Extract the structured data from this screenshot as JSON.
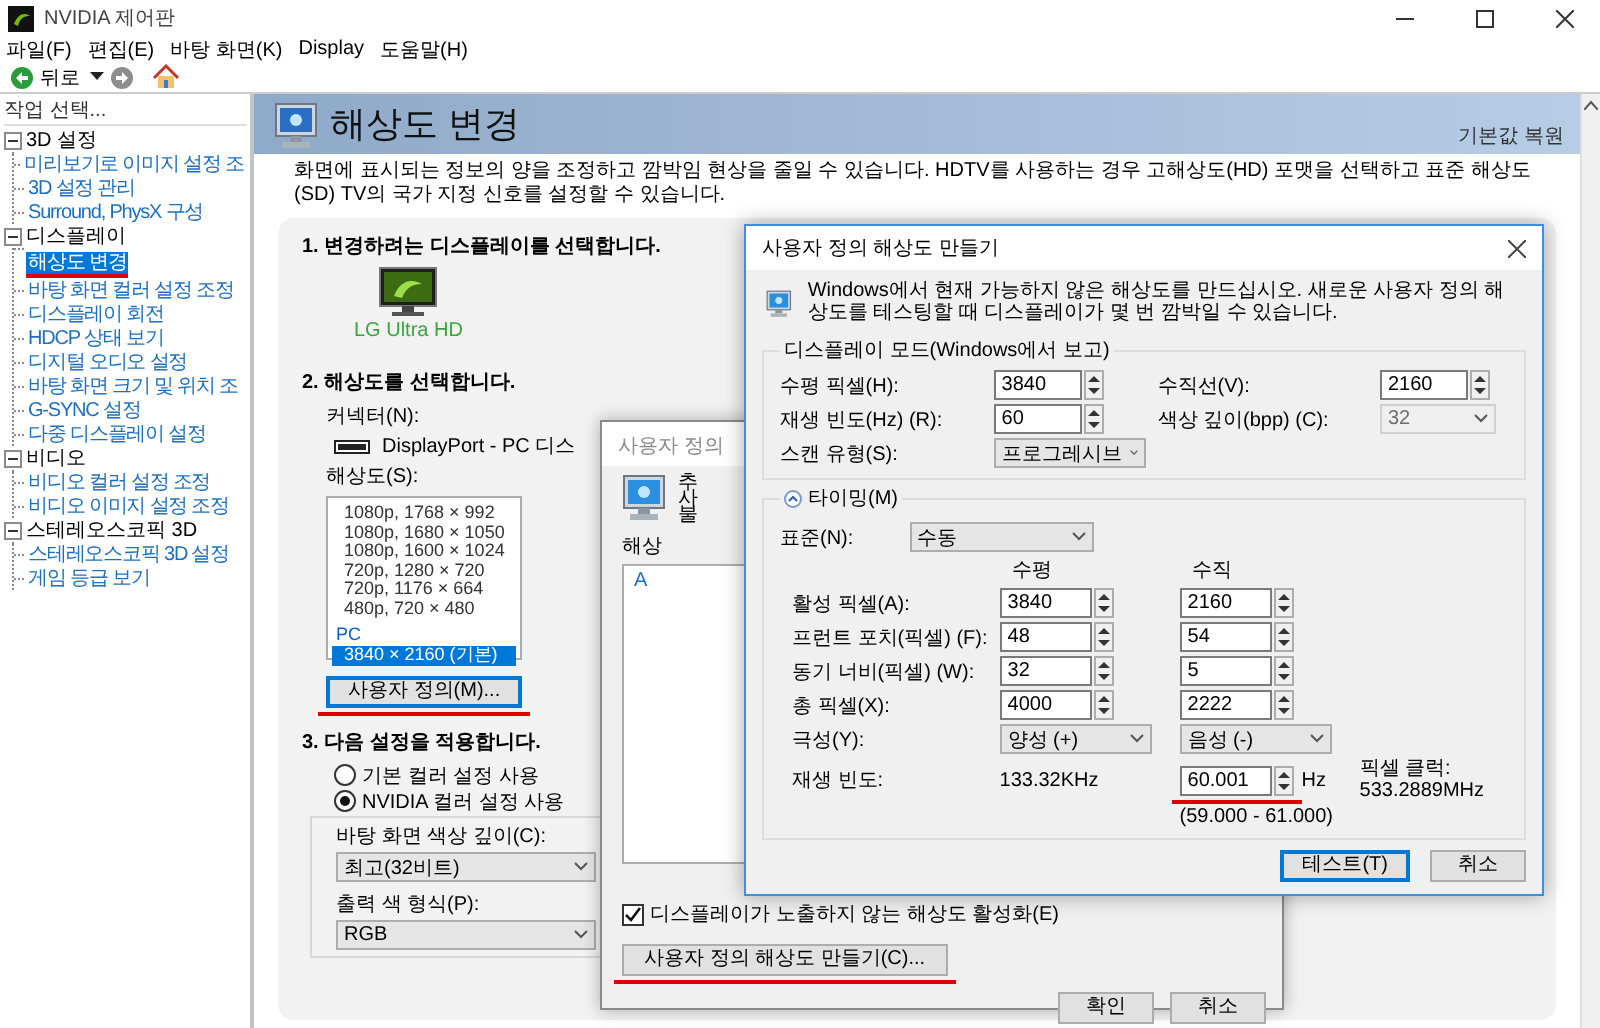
{
  "window": {
    "title": "NVIDIA 제어판"
  },
  "menu": [
    "파일(F)",
    "편집(E)",
    "바탕 화면(K)",
    "Display",
    "도움말(H)"
  ],
  "toolbar": {
    "back": "뒤로"
  },
  "sidebar": {
    "caption": "작업 선택...",
    "tree": [
      {
        "label": "3D 설정",
        "expanded": true,
        "children": [
          {
            "label": "미리보기로 이미지 설정 조",
            "selected": false,
            "annotated": false
          },
          {
            "label": "3D 설정 관리",
            "selected": false,
            "annotated": false
          },
          {
            "label": "Surround, PhysX 구성",
            "selected": false,
            "annotated": false
          }
        ]
      },
      {
        "label": "디스플레이",
        "expanded": true,
        "children": [
          {
            "label": "해상도 변경",
            "selected": true,
            "annotated": true
          },
          {
            "label": "바탕 화면 컬러 설정 조정",
            "selected": false,
            "annotated": false
          },
          {
            "label": "디스플레이 회전",
            "selected": false,
            "annotated": false
          },
          {
            "label": "HDCP 상태 보기",
            "selected": false,
            "annotated": false
          },
          {
            "label": "디지털 오디오 설정",
            "selected": false,
            "annotated": false
          },
          {
            "label": "바탕 화면 크기 및 위치 조",
            "selected": false,
            "annotated": false
          },
          {
            "label": "G-SYNC 설정",
            "selected": false,
            "annotated": false
          },
          {
            "label": "다중 디스플레이 설정",
            "selected": false,
            "annotated": false
          }
        ]
      },
      {
        "label": "비디오",
        "expanded": true,
        "children": [
          {
            "label": "비디오 컬러 설정 조정",
            "selected": false,
            "annotated": false
          },
          {
            "label": "비디오 이미지 설정 조정",
            "selected": false,
            "annotated": false
          }
        ]
      },
      {
        "label": "스테레오스코픽 3D",
        "expanded": true,
        "children": [
          {
            "label": "스테레오스코픽 3D 설정",
            "selected": false,
            "annotated": false
          },
          {
            "label": "게임 등급 보기",
            "selected": false,
            "annotated": false
          }
        ]
      }
    ]
  },
  "page": {
    "title": "해상도 변경",
    "restore": "기본값 복원",
    "description": "화면에 표시되는 정보의 양을 조정하고 깜박임 현상을 줄일 수 있습니다. HDTV를 사용하는 경우 고해상도(HD) 포맷을 선택하고 표준 해상도(SD) TV의 국가 지정 신호를 설정할 수 있습니다.",
    "step1": {
      "heading": "1. 변경하려는 디스플레이를 선택합니다.",
      "display": "LG Ultra HD"
    },
    "step2": {
      "heading": "2. 해상도를 선택합니다.",
      "connector_label": "커넥터(N):",
      "connector": "DisplayPort - PC 디스",
      "resolution_label": "해상도(S):",
      "resolutions": [
        {
          "label": "1080p, 1768 × 992",
          "kind": "item",
          "selected": false
        },
        {
          "label": "1080p, 1680 × 1050",
          "kind": "item",
          "selected": false
        },
        {
          "label": "1080p, 1600 × 1024",
          "kind": "item",
          "selected": false
        },
        {
          "label": "720p, 1280 × 720",
          "kind": "item",
          "selected": false
        },
        {
          "label": "720p, 1176 × 664",
          "kind": "item",
          "selected": false
        },
        {
          "label": "480p, 720 × 480",
          "kind": "item",
          "selected": false
        },
        {
          "label": "PC",
          "kind": "group"
        },
        {
          "label": "3840 × 2160 (기본)",
          "kind": "item",
          "selected": true
        }
      ],
      "customize_button": {
        "label": "사용자 정의(M)...",
        "annotated": true
      }
    },
    "step3": {
      "heading": "3. 다음 설정을 적용합니다.",
      "color_modes": [
        {
          "label": "기본 컬러 설정 사용",
          "selected": false
        },
        {
          "label": "NVIDIA 컬러 설정 사용",
          "selected": true
        }
      ],
      "depth_label": "바탕 화면 색상 깊이(C):",
      "depth": "최고(32비트)",
      "format_label": "출력 색 형식(P):",
      "format": "RGB"
    }
  },
  "custom_dialog": {
    "title": "사용자 정의",
    "description_lines": [
      "추",
      "사",
      "불"
    ],
    "list_label": "해상",
    "list": [
      "A"
    ],
    "enable_checkbox": {
      "label": "디스플레이가 노출하지 않는 해상도 활성화(E)",
      "checked": true
    },
    "create_button": {
      "label": "사용자 정의 해상도 만들기(C)...",
      "annotated": true
    },
    "buttons": [
      "확인",
      "취소"
    ]
  },
  "create_dialog": {
    "title": "사용자 정의 해상도 만들기",
    "description": "Windows에서 현재 가능하지 않은 해상도를 만드십시오. 새로운 사용자 정의 해상도를 테스팅할 때 디스플레이가 몇 번 깜박일 수 있습니다.",
    "mode_group": "디스플레이 모드(Windows에서 보고)",
    "mode_fields": [
      {
        "label": "수평 픽셀(H):",
        "value": "3840",
        "kind": "spin",
        "disabled": false
      },
      {
        "label": "수직선(V):",
        "value": "2160",
        "kind": "spin",
        "disabled": false
      },
      {
        "label": "재생 빈도(Hz) (R):",
        "value": "60",
        "kind": "spin",
        "disabled": false
      },
      {
        "label": "색상 깊이(bpp) (C):",
        "value": "32",
        "kind": "combo",
        "disabled": true
      },
      {
        "label": "스캔 유형(S):",
        "value": "프로그레시브",
        "kind": "combo",
        "disabled": false
      }
    ],
    "timing": {
      "label": "타이밍(M)",
      "expanded": true,
      "standard_label": "표준(N):",
      "standard": "수동",
      "columns": [
        "수평",
        "수직"
      ],
      "rows": [
        {
          "label": "활성 픽셀(A):",
          "kind": "spin",
          "horizontal": "3840",
          "vertical": "2160"
        },
        {
          "label": "프런트 포치(픽셀) (F):",
          "kind": "spin",
          "horizontal": "48",
          "vertical": "54"
        },
        {
          "label": "동기 너비(픽셀) (W):",
          "kind": "spin",
          "horizontal": "32",
          "vertical": "5"
        },
        {
          "label": "총 픽셀(X):",
          "kind": "spin",
          "horizontal": "4000",
          "vertical": "2222"
        },
        {
          "label": "극성(Y):",
          "kind": "combo",
          "horizontal": "양성 (+)",
          "vertical": "음성 (-)"
        },
        {
          "label": "재생 빈도:",
          "kind": "refresh",
          "horizontal": "133.32KHz",
          "vertical": "60.001",
          "unit": "Hz",
          "range": "(59.000 - 61.000)",
          "annotated": true
        }
      ],
      "pixel_clock_label": "픽셀 클럭:",
      "pixel_clock": "533.2889MHz"
    },
    "buttons": [
      {
        "label": "테스트(T)",
        "default": true
      },
      {
        "label": "취소",
        "default": false
      }
    ]
  }
}
